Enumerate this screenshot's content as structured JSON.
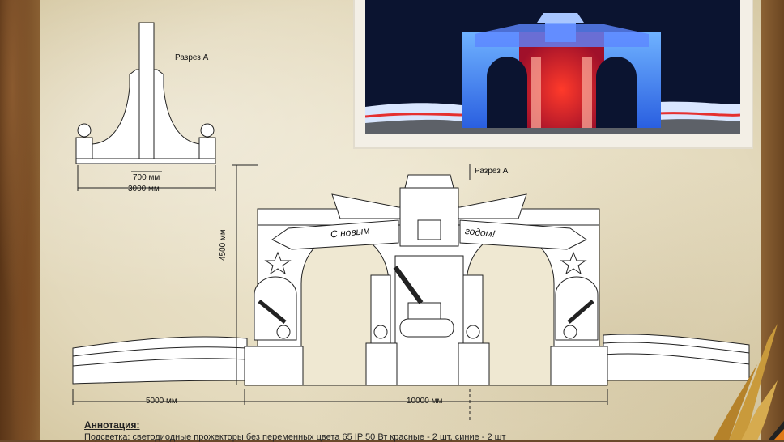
{
  "section_label": "Разрез А",
  "section_label_main": "Разрез А",
  "dim_700": "700 мм",
  "dim_3000": "3000 мм",
  "dim_4500": "4500 мм",
  "dim_5000": "5000 мм",
  "dim_10000": "10000 мм",
  "banner_left": "С новым",
  "banner_right": "годом!",
  "annotation_title": "Аннотация:",
  "annotation_text": "Подсветка: светодиодные прожекторы без переменных цвета 65 IP 50 Вт красные - 2 шт, синие - 2 шт"
}
